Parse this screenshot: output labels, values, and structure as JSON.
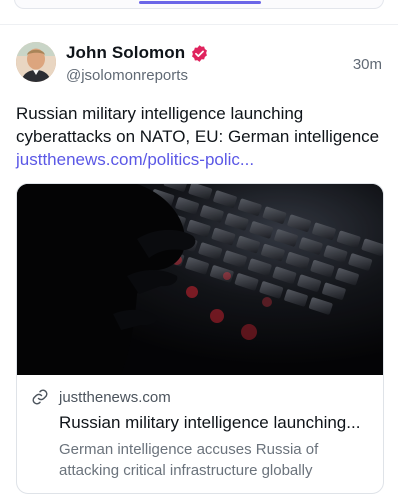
{
  "post": {
    "author": {
      "name": "John Solomon",
      "handle": "@jsolomonreports",
      "verified_icon": "verified-badge-icon",
      "avatar_icon": "avatar-photo"
    },
    "time": "30m",
    "text_prefix": "Russian military intelligence launching cyberattacks on NATO, EU: German intelligence",
    "text_link": "justthenews.com/politics-polic...",
    "link_color": "#5b58e6"
  },
  "card": {
    "domain": "justthenews.com",
    "title": "Russian military intelligence launching...",
    "description": "German intelligence accuses Russia of attacking critical infrastructure globally",
    "image_icon": "hacker-keyboard-photo",
    "link_icon": "link-icon"
  },
  "colors": {
    "accent": "#6b66e8",
    "verified": "#e0245e"
  }
}
